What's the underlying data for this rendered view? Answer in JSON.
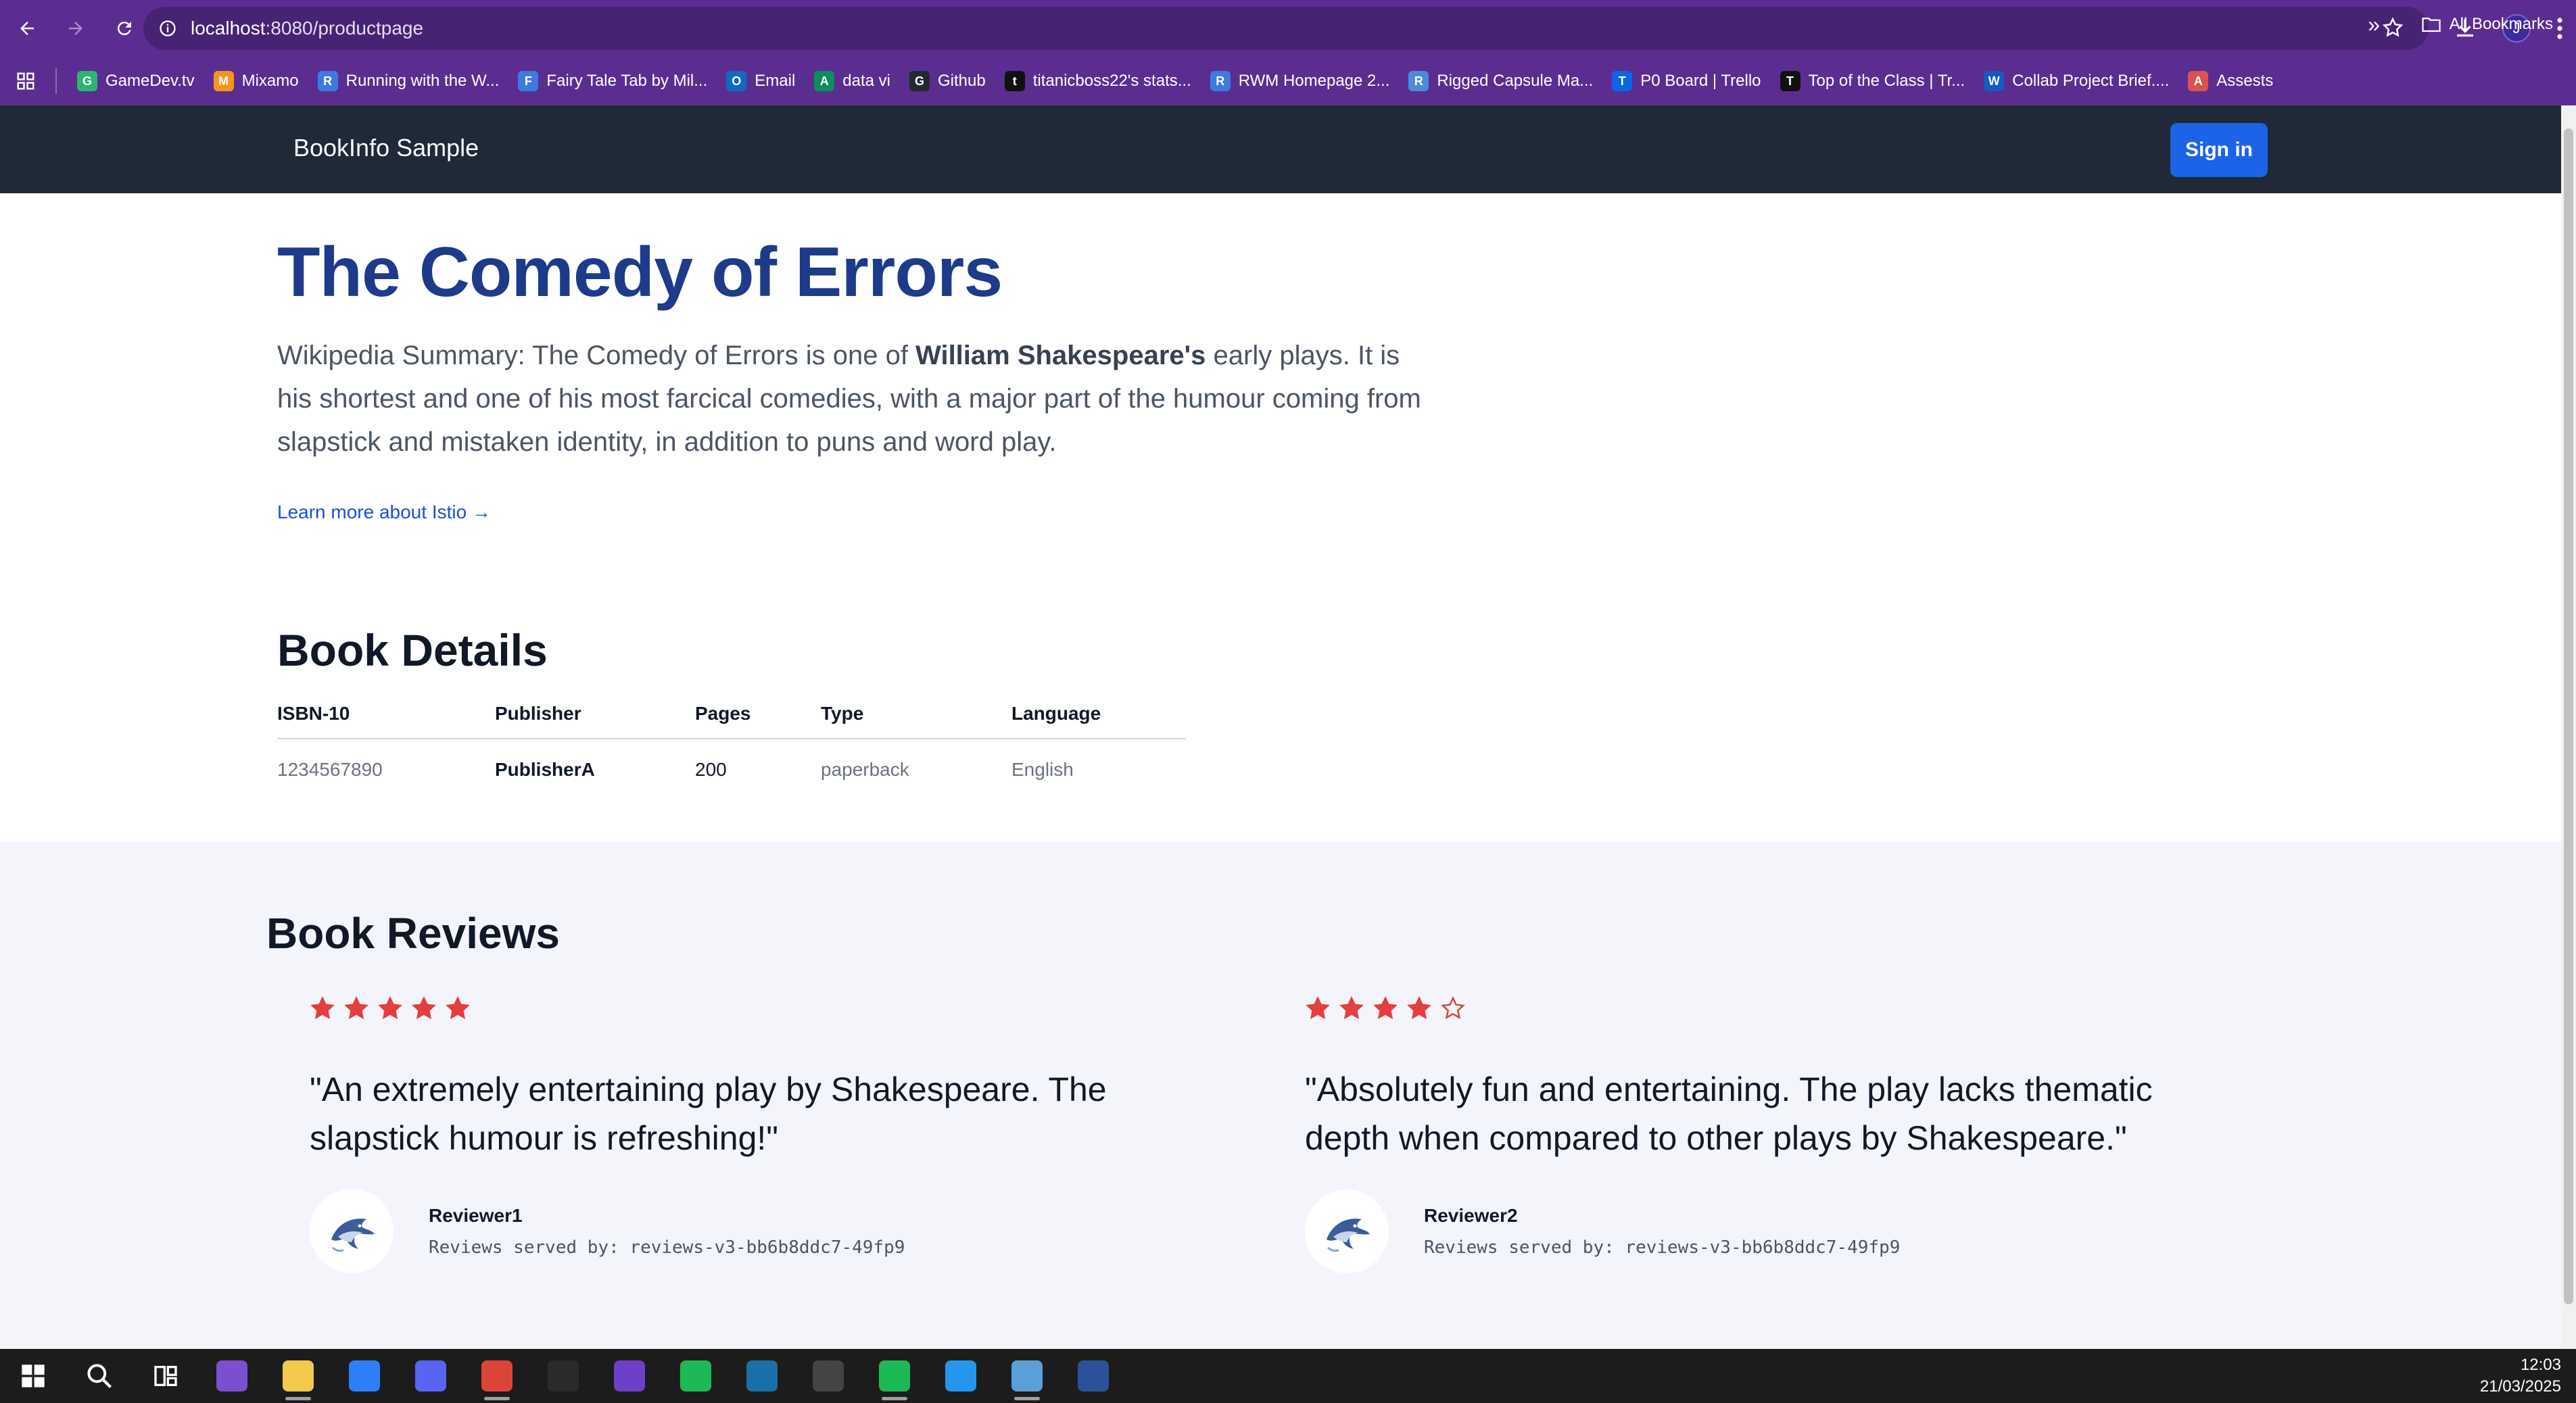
{
  "browser": {
    "url_host": "localhost",
    "url_path": ":8080/productpage",
    "profile_initial": "J"
  },
  "bookmarks": [
    {
      "label": "GameDev.tv",
      "color": "#2bb673",
      "glyph": "G"
    },
    {
      "label": "Mixamo",
      "color": "#f7941d",
      "glyph": "M"
    },
    {
      "label": "Running with the W...",
      "color": "#3d7be0",
      "glyph": "R"
    },
    {
      "label": "Fairy Tale Tab by Mil...",
      "color": "#3d7be0",
      "glyph": "F"
    },
    {
      "label": "Email",
      "color": "#0f6cbd",
      "glyph": "O"
    },
    {
      "label": "data vi",
      "color": "#0c8f5a",
      "glyph": "A"
    },
    {
      "label": "Github",
      "color": "#24292f",
      "glyph": "G"
    },
    {
      "label": "titanicboss22's stats...",
      "color": "#111111",
      "glyph": "t"
    },
    {
      "label": "RWM Homepage 2...",
      "color": "#3d7be0",
      "glyph": "R"
    },
    {
      "label": "Rigged Capsule Ma...",
      "color": "#4b8bd8",
      "glyph": "R"
    },
    {
      "label": "P0 Board | Trello",
      "color": "#0c66e4",
      "glyph": "T"
    },
    {
      "label": "Top of the Class | Tr...",
      "color": "#111111",
      "glyph": "T"
    },
    {
      "label": "Collab Project Brief....",
      "color": "#185abd",
      "glyph": "W"
    },
    {
      "label": "Assests",
      "color": "#d9534f",
      "glyph": "A"
    }
  ],
  "bookmarks_all": "All Bookmarks",
  "navbar": {
    "brand": "BookInfo Sample",
    "signin": "Sign in"
  },
  "product": {
    "title": "The Comedy of Errors",
    "summary_prefix": "Wikipedia Summary: The Comedy of Errors is one of ",
    "summary_bold": "William Shakespeare's",
    "summary_suffix": " early plays. It is his shortest and one of his most farcical comedies, with a major part of the humour coming from slapstick and mistaken identity, in addition to puns and word play.",
    "learn_more": "Learn more about Istio →"
  },
  "details": {
    "heading": "Book Details",
    "columns": [
      "ISBN-10",
      "Publisher",
      "Pages",
      "Type",
      "Language"
    ],
    "values": [
      "1234567890",
      "PublisherA",
      "200",
      "paperback",
      "English"
    ]
  },
  "reviews": {
    "heading": "Book Reviews",
    "star_color": "#e53e3e",
    "items": [
      {
        "rating": 5,
        "text": "\"An extremely entertaining play by Shakespeare. The slapstick humour is refreshing!\"",
        "reviewer": "Reviewer1",
        "served_by": "Reviews served by: reviews-v3-bb6b8ddc7-49fp9"
      },
      {
        "rating": 4,
        "text": "\"Absolutely fun and entertaining. The play lacks thematic depth when compared to other plays by Shakespeare.\"",
        "reviewer": "Reviewer2",
        "served_by": "Reviews served by: reviews-v3-bb6b8ddc7-49fp9"
      }
    ]
  },
  "taskbar": {
    "apps": [
      {
        "name": "start-icon",
        "color": "#1c1c1c"
      },
      {
        "name": "search-icon",
        "color": "#1c1c1c"
      },
      {
        "name": "task-view-icon",
        "color": "#1c1c1c"
      },
      {
        "name": "visual-studio-icon",
        "color": "#7b4fd0"
      },
      {
        "name": "file-explorer-icon",
        "color": "#f2c94c"
      },
      {
        "name": "microsoft-store-icon",
        "color": "#2d7ff9"
      },
      {
        "name": "discord-icon",
        "color": "#5865f2"
      },
      {
        "name": "chrome-icon",
        "color": "#db4437"
      },
      {
        "name": "terminal-icon",
        "color": "#2b2b2b"
      },
      {
        "name": "github-desktop-icon",
        "color": "#6e40c9"
      },
      {
        "name": "spotify-icon",
        "color": "#1db954"
      },
      {
        "name": "steam-icon",
        "color": "#1b6fa8"
      },
      {
        "name": "unity-icon",
        "color": "#444444"
      },
      {
        "name": "spotify-icon-2",
        "color": "#1db954"
      },
      {
        "name": "docker-icon",
        "color": "#2496ed"
      },
      {
        "name": "notepad-icon",
        "color": "#5aa0d8"
      },
      {
        "name": "powershell-icon",
        "color": "#2a5298"
      }
    ],
    "time": "12:03",
    "date": "21/03/2025"
  }
}
